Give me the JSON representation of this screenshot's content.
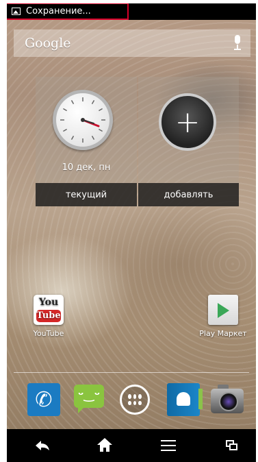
{
  "status_bar": {
    "notification_text": "Сохранение...",
    "notification_icon": "image-icon"
  },
  "search_bar": {
    "brand": "Google",
    "voice_icon": "mic-icon"
  },
  "widget": {
    "clock_date": "10 дек, пн",
    "left_button_label": "текущий",
    "right_button_label": "добавлять",
    "add_icon": "plus-icon"
  },
  "desktop_apps": [
    {
      "label": "YouTube",
      "icon": "youtube-icon",
      "icon_text_top": "You",
      "icon_text_bottom": "Tube"
    },
    {
      "label": "Play Маркет",
      "icon": "play-market-icon"
    }
  ],
  "dock": [
    {
      "icon": "phone-icon"
    },
    {
      "icon": "messaging-icon"
    },
    {
      "icon": "app-drawer-icon"
    },
    {
      "icon": "contacts-icon"
    },
    {
      "icon": "camera-icon"
    }
  ],
  "nav_bar": [
    {
      "icon": "back-icon"
    },
    {
      "icon": "home-icon"
    },
    {
      "icon": "menu-icon"
    },
    {
      "icon": "recent-apps-icon"
    }
  ],
  "colors": {
    "status_highlight": "#d6002a",
    "youtube_red": "#d52626",
    "play_green": "#3aa757",
    "phone_blue": "#1b7bc2",
    "messaging_green": "#8ac43f"
  }
}
